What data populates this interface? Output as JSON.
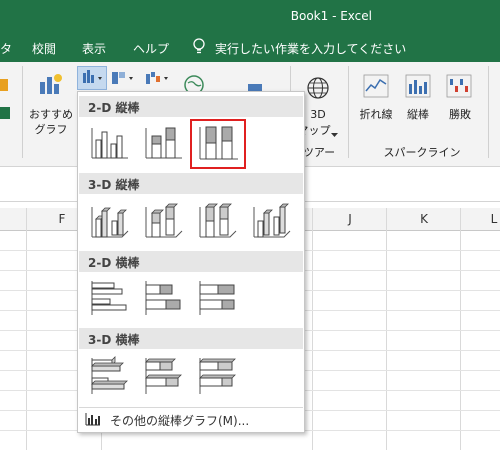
{
  "window": {
    "title": "Book1  -  Excel"
  },
  "menu": {
    "items": [
      "タ",
      "校閲",
      "表示",
      "ヘルプ"
    ],
    "tell_me": "実行したい作業を入力してください"
  },
  "ribbon": {
    "recommended_label_1": "おすすめ",
    "recommended_label_2": "グラフ",
    "map3d_label_1": "3D",
    "map3d_label_2": "マップ",
    "tour_group": "ツアー",
    "sparkline_line": "折れ線",
    "sparkline_column": "縦棒",
    "sparkline_winloss": "勝敗",
    "sparkline_group": "スパークライン"
  },
  "columns": [
    "F",
    "J",
    "K",
    "L"
  ],
  "dropdown": {
    "sections": [
      {
        "title": "2-D 縦棒"
      },
      {
        "title": "3-D 縦棒"
      },
      {
        "title": "2-D 横棒"
      },
      {
        "title": "3-D 横棒"
      }
    ],
    "more_label": "その他の縦棒グラフ(M)..."
  },
  "colors": {
    "excel_green": "#217346",
    "selection_red": "#e02020"
  }
}
